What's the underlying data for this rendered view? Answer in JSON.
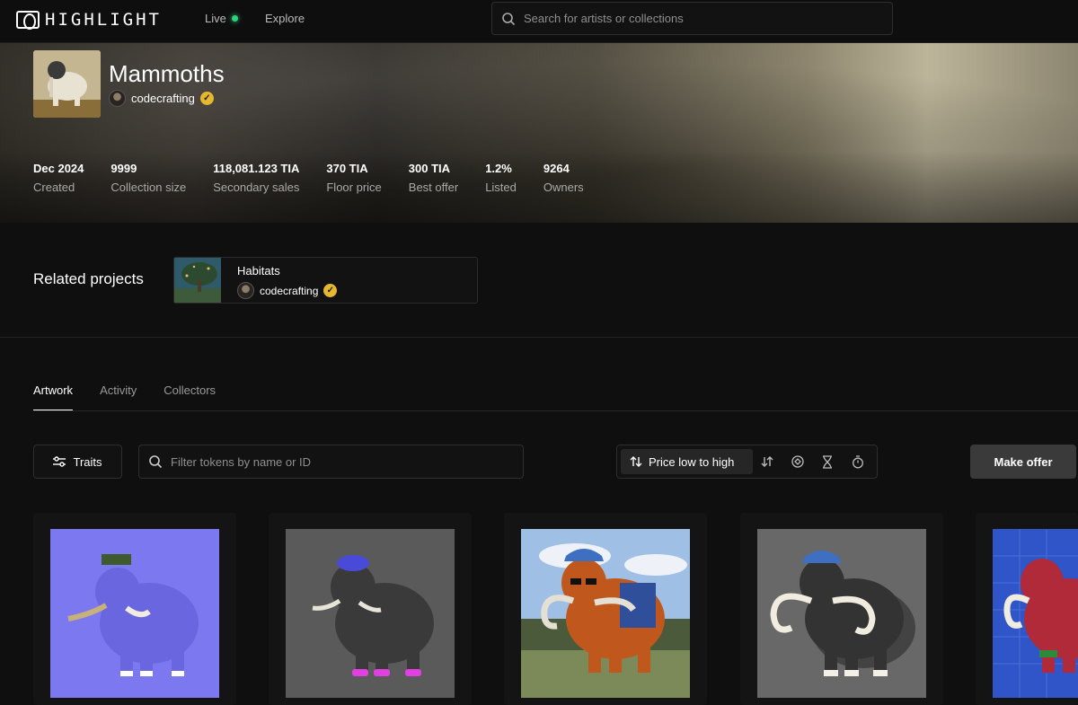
{
  "nav": {
    "brand": "HIGHLIGHT",
    "live_label": "Live",
    "explore_label": "Explore",
    "search_placeholder": "Search for artists or collections"
  },
  "collection": {
    "title": "Mammoths",
    "creator": "codecrafting",
    "stats": [
      {
        "value": "Dec 2024",
        "label": "Created"
      },
      {
        "value": "9999",
        "label": "Collection size"
      },
      {
        "value": "118,081.123 TIA",
        "label": "Secondary sales"
      },
      {
        "value": "370 TIA",
        "label": "Floor price"
      },
      {
        "value": "300 TIA",
        "label": "Best offer"
      },
      {
        "value": "1.2%",
        "label": "Listed"
      },
      {
        "value": "9264",
        "label": "Owners"
      }
    ]
  },
  "related": {
    "label": "Related projects",
    "project": {
      "name": "Habitats",
      "creator": "codecrafting"
    }
  },
  "tabs": [
    {
      "label": "Artwork",
      "active": true
    },
    {
      "label": "Activity",
      "active": false
    },
    {
      "label": "Collectors",
      "active": false
    }
  ],
  "controls": {
    "traits_label": "Traits",
    "filter_placeholder": "Filter tokens by name or ID",
    "sort_label": "Price low to high",
    "make_offer_label": "Make offer"
  },
  "colors": {
    "live_dot": "#2fd27a",
    "verified_badge": "#e6b82d"
  }
}
